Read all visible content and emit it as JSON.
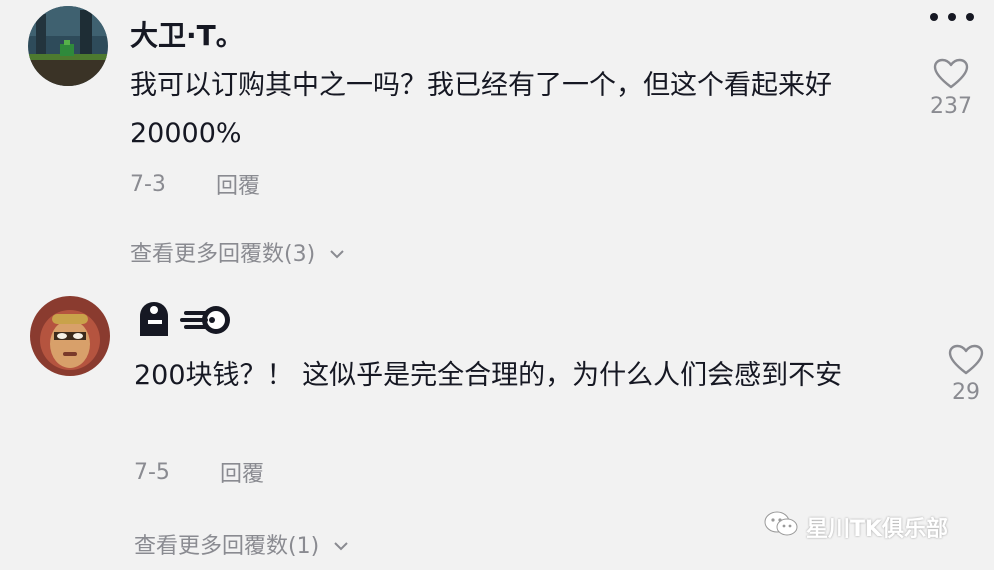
{
  "comments": [
    {
      "username": "大卫·T。",
      "text": "我可以订购其中之一吗？我已经有了一个，但这个看起来好 20000%",
      "date": "7-3",
      "reply_label": "回覆",
      "view_more": "查看更多回覆数(3)",
      "likes": "237"
    },
    {
      "username": "",
      "text": "200块钱？！ 这似乎是完全合理的，为什么人们会感到不安",
      "date": "7-5",
      "reply_label": "回覆",
      "view_more": "查看更多回覆数(1)",
      "likes": "29"
    }
  ],
  "watermark": {
    "text": "星川TK俱乐部"
  },
  "icons": {
    "more": "more-options-icon",
    "like": "heart-outline-icon",
    "expand": "chevron-down-icon",
    "watermark": "wechat-icon",
    "username_emoji": "emoji-icons"
  },
  "colors": {
    "background": "#f2f2f2",
    "text": "#161823",
    "secondary": "#8a8b91"
  }
}
